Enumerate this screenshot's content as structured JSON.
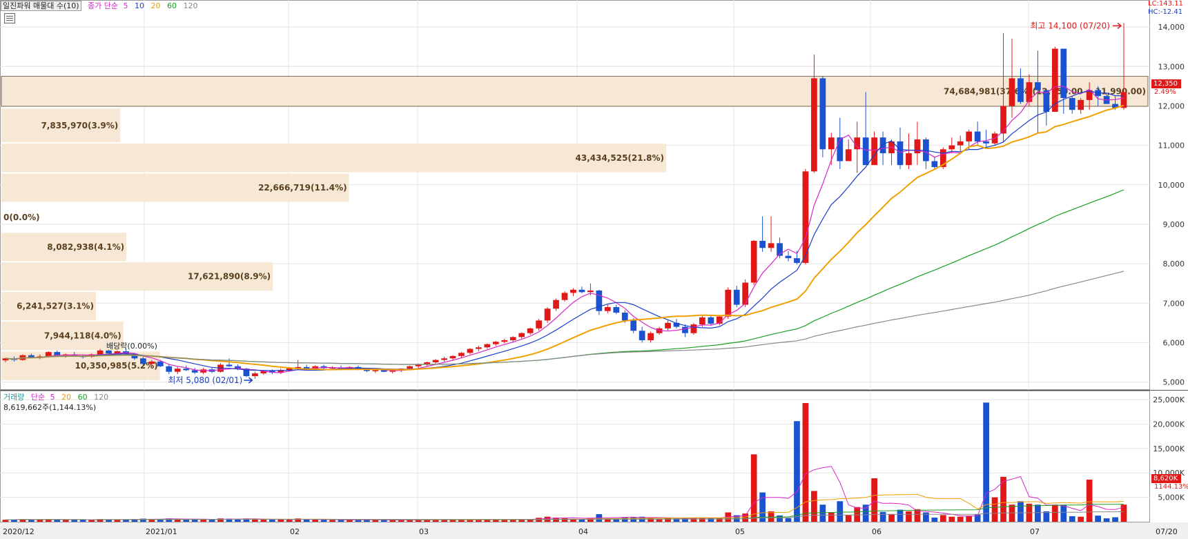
{
  "legend": {
    "title": "일진파워 매물대 수(10)",
    "price_ma_label": "종가 단순",
    "ma_periods": [
      "5",
      "10",
      "20",
      "60",
      "120"
    ],
    "ma_colors": [
      "#d826c8",
      "#1a3ec8",
      "#f0a000",
      "#18a020",
      "#888888"
    ]
  },
  "volume_legend": {
    "title": "거래량",
    "ma_label": "단순",
    "ma_periods": [
      "5",
      "20",
      "60",
      "120"
    ],
    "sub": "8,619,662주(1,144.13%)"
  },
  "top_right": {
    "lc": "LC:143.11",
    "hc": "HC:-12.41"
  },
  "last_price": {
    "value": "12,350",
    "change": "2.49%"
  },
  "last_volume": {
    "value": "8,620K",
    "pct": "1144.13%"
  },
  "annotations": {
    "high": "최고 14,100 (07/20)",
    "low": "최저 5,080 (02/01)",
    "dividend": "배당락(0.00%)"
  },
  "chart_data": {
    "type": "candlestick",
    "price_axis": {
      "ylim": [
        4800,
        14300
      ],
      "ticks": [
        "5,000",
        "6,000",
        "7,000",
        "8,000",
        "9,000",
        "10,000",
        "11,000",
        "12,000",
        "13,000",
        "14,000"
      ]
    },
    "volume_axis": {
      "ylim": [
        0,
        26000
      ],
      "ticks": [
        "5,000K",
        "10,000K",
        "15,000K",
        "20,000K",
        "25,000K"
      ]
    },
    "x_labels": [
      "2020/12",
      "2021/01",
      "02",
      "03",
      "04",
      "05",
      "06",
      "07",
      "07/20"
    ],
    "volume_profile": [
      {
        "label": "10,350,985(5.2%)",
        "range": [
          5030,
          5790
        ],
        "share": 5.2
      },
      {
        "label": "7,944,118(4.0%)",
        "range": [
          5790,
          6550
        ],
        "share": 4.0
      },
      {
        "label": "6,241,527(3.1%)",
        "range": [
          6550,
          7300
        ],
        "share": 3.1
      },
      {
        "label": "17,621,890(8.9%)",
        "range": [
          7300,
          8050
        ],
        "share": 8.9
      },
      {
        "label": "8,082,938(4.1%)",
        "range": [
          8050,
          8800
        ],
        "share": 4.1
      },
      {
        "label": "0(0.0%)",
        "range": [
          8800,
          9550
        ],
        "share": 0.0
      },
      {
        "label": "22,666,719(11.4%)",
        "range": [
          9550,
          10300
        ],
        "share": 11.4
      },
      {
        "label": "43,434,525(21.8%)",
        "range": [
          10300,
          11060
        ],
        "share": 21.8
      },
      {
        "label": "7,835,970(3.9%)",
        "range": [
          11060,
          11950
        ],
        "share": 3.9
      },
      {
        "label": "74,684,981(37.6%)(12,750.00 ~ 11,990.00)",
        "range": [
          11990,
          12750
        ],
        "share": 37.6
      }
    ],
    "candles_ohlc_approx": [
      [
        5550,
        5620,
        5500,
        5600
      ],
      [
        5600,
        5650,
        5520,
        5560
      ],
      [
        5560,
        5700,
        5540,
        5680
      ],
      [
        5680,
        5720,
        5600,
        5620
      ],
      [
        5620,
        5700,
        5580,
        5650
      ],
      [
        5650,
        5780,
        5620,
        5760
      ],
      [
        5760,
        5800,
        5650,
        5680
      ],
      [
        5680,
        5720,
        5620,
        5700
      ],
      [
        5700,
        5760,
        5640,
        5660
      ],
      [
        5660,
        5700,
        5600,
        5640
      ],
      [
        5640,
        5720,
        5620,
        5700
      ],
      [
        5700,
        5840,
        5660,
        5800
      ],
      [
        5800,
        5820,
        5700,
        5720
      ],
      [
        5720,
        5800,
        5690,
        5780
      ],
      [
        5780,
        5850,
        5700,
        5720
      ],
      [
        5720,
        5740,
        5560,
        5600
      ],
      [
        5600,
        5640,
        5420,
        5460
      ],
      [
        5460,
        5560,
        5400,
        5520
      ],
      [
        5520,
        5560,
        5380,
        5400
      ],
      [
        5400,
        5440,
        5200,
        5260
      ],
      [
        5260,
        5380,
        5200,
        5340
      ],
      [
        5340,
        5420,
        5280,
        5300
      ],
      [
        5300,
        5360,
        5200,
        5240
      ],
      [
        5240,
        5360,
        5200,
        5320
      ],
      [
        5320,
        5360,
        5230,
        5260
      ],
      [
        5260,
        5480,
        5240,
        5440
      ],
      [
        5440,
        5600,
        5380,
        5400
      ],
      [
        5400,
        5450,
        5300,
        5340
      ],
      [
        5340,
        5360,
        5120,
        5150
      ],
      [
        5150,
        5260,
        5080,
        5220
      ],
      [
        5220,
        5300,
        5180,
        5280
      ],
      [
        5280,
        5320,
        5200,
        5240
      ],
      [
        5240,
        5340,
        5200,
        5300
      ],
      [
        5300,
        5380,
        5260,
        5360
      ],
      [
        5360,
        5560,
        5320,
        5380
      ],
      [
        5380,
        5440,
        5300,
        5340
      ],
      [
        5340,
        5420,
        5300,
        5400
      ],
      [
        5400,
        5440,
        5330,
        5350
      ],
      [
        5350,
        5400,
        5300,
        5370
      ],
      [
        5370,
        5420,
        5320,
        5330
      ],
      [
        5330,
        5400,
        5300,
        5380
      ],
      [
        5380,
        5420,
        5300,
        5320
      ],
      [
        5320,
        5360,
        5250,
        5280
      ],
      [
        5280,
        5320,
        5230,
        5300
      ],
      [
        5300,
        5340,
        5250,
        5260
      ],
      [
        5260,
        5310,
        5220,
        5290
      ],
      [
        5290,
        5350,
        5250,
        5340
      ],
      [
        5340,
        5420,
        5300,
        5400
      ],
      [
        5400,
        5470,
        5360,
        5440
      ],
      [
        5440,
        5520,
        5400,
        5500
      ],
      [
        5500,
        5580,
        5460,
        5560
      ],
      [
        5560,
        5640,
        5520,
        5600
      ],
      [
        5600,
        5680,
        5560,
        5660
      ],
      [
        5660,
        5760,
        5620,
        5740
      ],
      [
        5740,
        5860,
        5700,
        5840
      ],
      [
        5840,
        5920,
        5780,
        5880
      ],
      [
        5880,
        5980,
        5840,
        5960
      ],
      [
        5960,
        6040,
        5920,
        6020
      ],
      [
        6020,
        6100,
        5980,
        6060
      ],
      [
        6060,
        6160,
        6000,
        6140
      ],
      [
        6140,
        6260,
        6100,
        6240
      ],
      [
        6240,
        6380,
        6200,
        6360
      ],
      [
        6360,
        6600,
        6300,
        6560
      ],
      [
        6560,
        6900,
        6500,
        6860
      ],
      [
        6860,
        7120,
        6800,
        7080
      ],
      [
        7080,
        7300,
        7040,
        7260
      ],
      [
        7260,
        7380,
        7180,
        7340
      ],
      [
        7340,
        7420,
        7250,
        7280
      ],
      [
        7280,
        7500,
        7200,
        7320
      ],
      [
        7320,
        7340,
        6700,
        6800
      ],
      [
        6800,
        6960,
        6740,
        6900
      ],
      [
        6900,
        6960,
        6720,
        6760
      ],
      [
        6760,
        6820,
        6500,
        6560
      ],
      [
        6560,
        6620,
        6240,
        6300
      ],
      [
        6300,
        6400,
        6000,
        6060
      ],
      [
        6060,
        6280,
        6000,
        6240
      ],
      [
        6240,
        6400,
        6200,
        6360
      ],
      [
        6360,
        6560,
        6300,
        6500
      ],
      [
        6500,
        6600,
        6360,
        6400
      ],
      [
        6400,
        6460,
        6140,
        6240
      ],
      [
        6240,
        6500,
        6200,
        6460
      ],
      [
        6460,
        6700,
        6400,
        6640
      ],
      [
        6640,
        6680,
        6420,
        6480
      ],
      [
        6480,
        6700,
        6440,
        6660
      ],
      [
        6660,
        7400,
        6600,
        7340
      ],
      [
        7340,
        7440,
        6900,
        6960
      ],
      [
        6960,
        7600,
        6900,
        7520
      ],
      [
        7520,
        8600,
        7460,
        8580
      ],
      [
        8580,
        9200,
        8300,
        8400
      ],
      [
        8400,
        9200,
        8300,
        8520
      ],
      [
        8520,
        8660,
        8140,
        8200
      ],
      [
        8200,
        8320,
        8060,
        8140
      ],
      [
        8140,
        8320,
        7980,
        8020
      ],
      [
        8020,
        10400,
        7980,
        10340
      ],
      [
        10340,
        13300,
        10300,
        12700
      ],
      [
        12700,
        12750,
        10700,
        10900
      ],
      [
        10900,
        11320,
        10500,
        11200
      ],
      [
        11200,
        11700,
        10400,
        10600
      ],
      [
        10600,
        11150,
        10600,
        10900
      ],
      [
        10900,
        11600,
        10300,
        11200
      ],
      [
        11200,
        12350,
        10500,
        10500
      ],
      [
        10500,
        11350,
        10500,
        11200
      ],
      [
        11200,
        11350,
        10500,
        10800
      ],
      [
        10800,
        11150,
        10500,
        11100
      ],
      [
        11100,
        11450,
        10400,
        10500
      ],
      [
        10500,
        11300,
        10400,
        10800
      ],
      [
        10800,
        11600,
        10500,
        11150
      ],
      [
        11150,
        11200,
        10400,
        10600
      ],
      [
        10600,
        10700,
        10380,
        10450
      ],
      [
        10450,
        10950,
        10400,
        10900
      ],
      [
        10900,
        11200,
        10800,
        11000
      ],
      [
        11000,
        11250,
        10850,
        11100
      ],
      [
        11100,
        11400,
        10900,
        11350
      ],
      [
        11350,
        11600,
        11000,
        11100
      ],
      [
        11100,
        11400,
        10950,
        11050
      ],
      [
        11050,
        11350,
        11000,
        11300
      ],
      [
        11300,
        13850,
        11100,
        12000
      ],
      [
        12000,
        13700,
        11700,
        12700
      ],
      [
        12700,
        12950,
        12050,
        12100
      ],
      [
        12100,
        12800,
        12000,
        12600
      ],
      [
        12600,
        13400,
        11300,
        12400
      ],
      [
        12400,
        12400,
        11500,
        11850
      ],
      [
        11850,
        13500,
        11850,
        13450
      ],
      [
        13450,
        13450,
        11800,
        12200
      ],
      [
        12200,
        12250,
        11800,
        11900
      ],
      [
        11900,
        12200,
        11800,
        12150
      ],
      [
        12150,
        12600,
        11900,
        12400
      ],
      [
        12400,
        12500,
        12000,
        12250
      ],
      [
        12250,
        12300,
        12050,
        12050
      ],
      [
        12050,
        12250,
        11900,
        11950
      ],
      [
        11950,
        14100,
        11900,
        12350
      ]
    ],
    "volume_bars_k_approx": {
      "notable": [
        {
          "at": "06 first week",
          "value": 13800
        },
        {
          "at": "06 second week",
          "value": 20600
        },
        {
          "at": "06 second week",
          "value": 24300
        },
        {
          "at": "07 second week",
          "value": 24400
        },
        {
          "at": "07/20",
          "value": 8620
        }
      ]
    }
  }
}
